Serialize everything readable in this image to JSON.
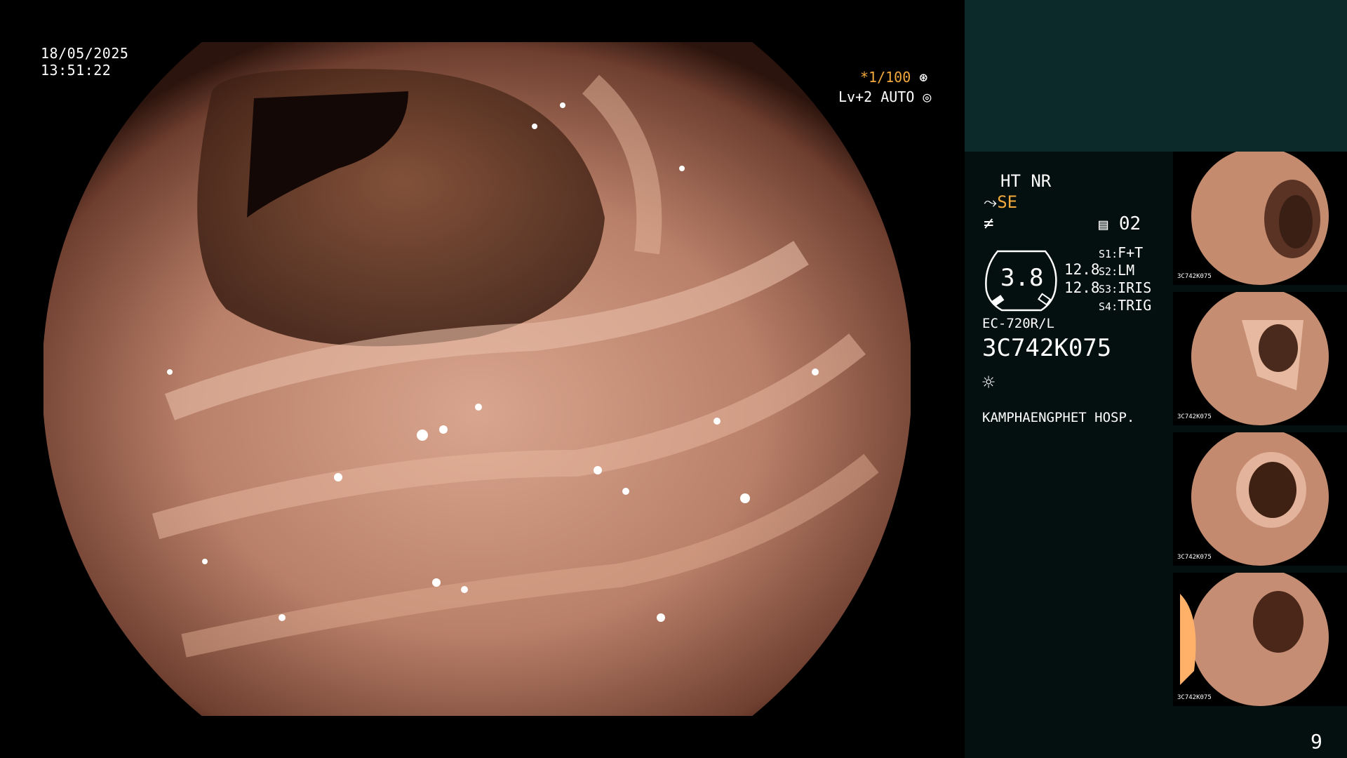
{
  "overlay": {
    "date": "18/05/2025",
    "time": "13:51:22",
    "shutter": "*1/100",
    "level": "Lv+2 AUTO",
    "shutter_icon": "aperture-icon",
    "auto_icon": "iris-icon"
  },
  "panel": {
    "mode_line": "HT NR",
    "se_label": "SE",
    "se_color": "#f2a93b",
    "record_number": "02",
    "gauge_value": "3.8",
    "value_top": "12.8",
    "value_bottom": "12.8",
    "switches": [
      {
        "key": "S1",
        "value": "F+T"
      },
      {
        "key": "S2",
        "value": "LM"
      },
      {
        "key": "S3",
        "value": "IRIS"
      },
      {
        "key": "S4",
        "value": "TRIG"
      }
    ],
    "scope_model": "EC-720R/L",
    "scope_serial": "3C742K075",
    "hospital": "KAMPHAENGPHET HOSP.",
    "light_icon": "sun-icon"
  },
  "thumbnails": [
    {
      "id": "thumb-1",
      "caption": "3C742K075"
    },
    {
      "id": "thumb-2",
      "caption": "3C742K075"
    },
    {
      "id": "thumb-3",
      "caption": "3C742K075"
    },
    {
      "id": "thumb-4",
      "caption": "3C742K075"
    }
  ],
  "page_number": "9",
  "colors": {
    "panel_bg": "#04100f",
    "panel_top": "#0d2a2b",
    "tissue": "#b07a64"
  }
}
